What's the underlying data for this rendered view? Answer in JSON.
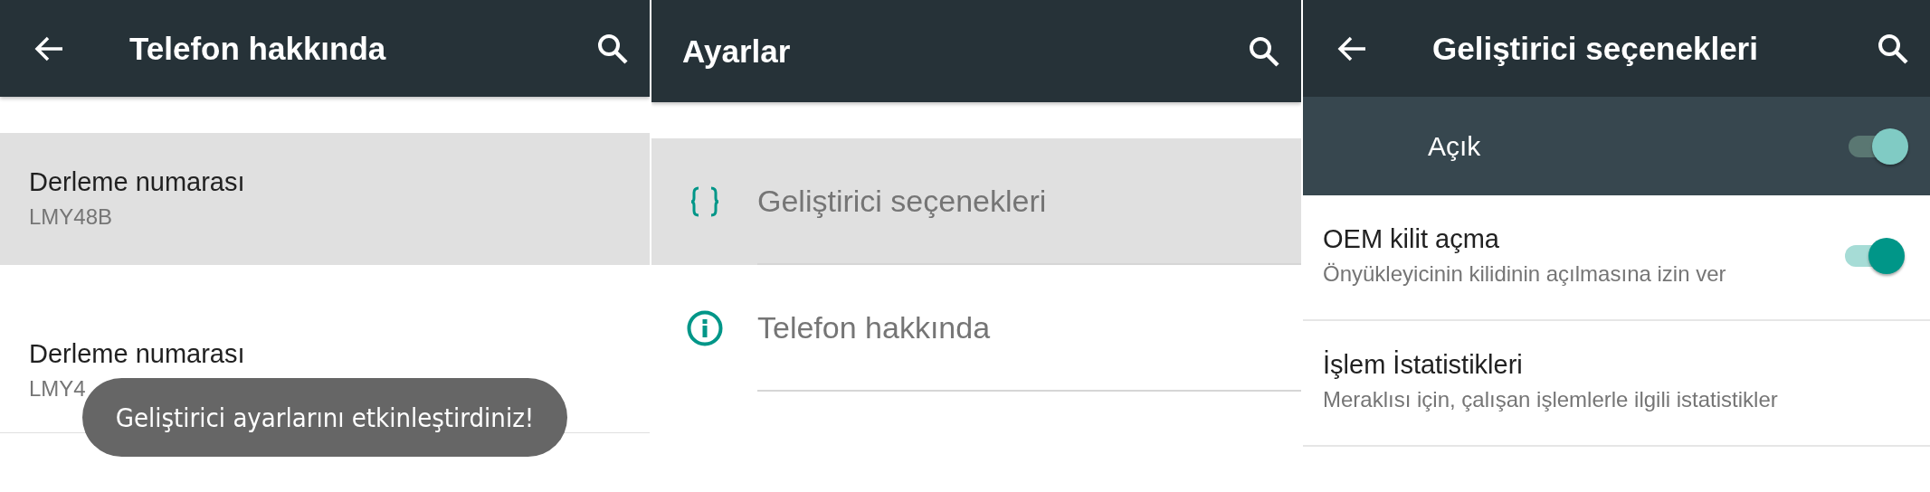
{
  "panels": [
    {
      "app_bar": {
        "title": "Telefon hakkında",
        "back": true
      },
      "items": [
        {
          "kind": "two_line",
          "title": "Derleme numarası",
          "subtitle": "LMY48B",
          "selected": true
        },
        {
          "kind": "two_line",
          "title": "Derleme numarası",
          "subtitle": "LMY4",
          "selected": false
        }
      ],
      "toast": "Geliştirici ayarlarını etkinleştirdiniz!"
    },
    {
      "app_bar": {
        "title": "Ayarlar",
        "back": false
      },
      "items": [
        {
          "kind": "icon_row",
          "title": "Geliştirici seçenekleri",
          "selected": true
        },
        {
          "kind": "icon_row",
          "title": "Telefon hakkında",
          "selected": false
        }
      ]
    },
    {
      "app_bar": {
        "title": "Geliştirici seçenekleri",
        "back": true
      },
      "items": [
        {
          "kind": "master_switch",
          "title": "Açık",
          "on": true
        },
        {
          "kind": "switch",
          "title": "OEM kilit açma",
          "subtitle": "Önyükleyicinin kilidinin açılmasına izin ver",
          "on": true
        },
        {
          "kind": "two_line",
          "title": "İşlem İstatistikleri",
          "subtitle": "Meraklısı için, çalışan işlemlerle ilgili istatistikler",
          "selected": false
        }
      ]
    }
  ]
}
